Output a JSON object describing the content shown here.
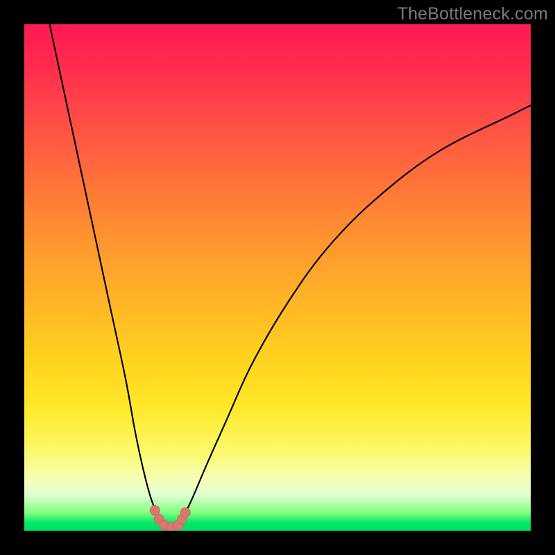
{
  "watermark": "TheBottleneck.com",
  "colors": {
    "background": "#000000",
    "curve": "#000000",
    "marker": "#d77a6e",
    "marker_stroke": "#c86a5e"
  },
  "chart_data": {
    "type": "line",
    "title": "",
    "xlabel": "",
    "ylabel": "",
    "xlim": [
      0,
      100
    ],
    "ylim": [
      0,
      100
    ],
    "series": [
      {
        "name": "left-branch",
        "x": [
          5,
          8,
          11,
          14,
          17,
          20,
          22,
          24,
          25.5,
          27
        ],
        "y": [
          100,
          86,
          72,
          58,
          44,
          30,
          19,
          10,
          5,
          2
        ]
      },
      {
        "name": "right-branch",
        "x": [
          31,
          33,
          36,
          40,
          45,
          52,
          60,
          70,
          82,
          96,
          100
        ],
        "y": [
          2,
          6,
          13,
          22,
          33,
          45,
          56,
          66,
          75,
          82,
          84
        ]
      },
      {
        "name": "trough",
        "x": [
          27,
          28,
          29,
          30,
          31
        ],
        "y": [
          2,
          0.6,
          0.3,
          0.6,
          2
        ]
      }
    ],
    "markers": {
      "name": "trough-markers",
      "x": [
        25.8,
        26.6,
        27.6,
        29.0,
        30.4,
        31.2,
        31.8
      ],
      "y": [
        4.0,
        2.3,
        1.1,
        0.7,
        1.1,
        2.3,
        3.6
      ]
    }
  }
}
